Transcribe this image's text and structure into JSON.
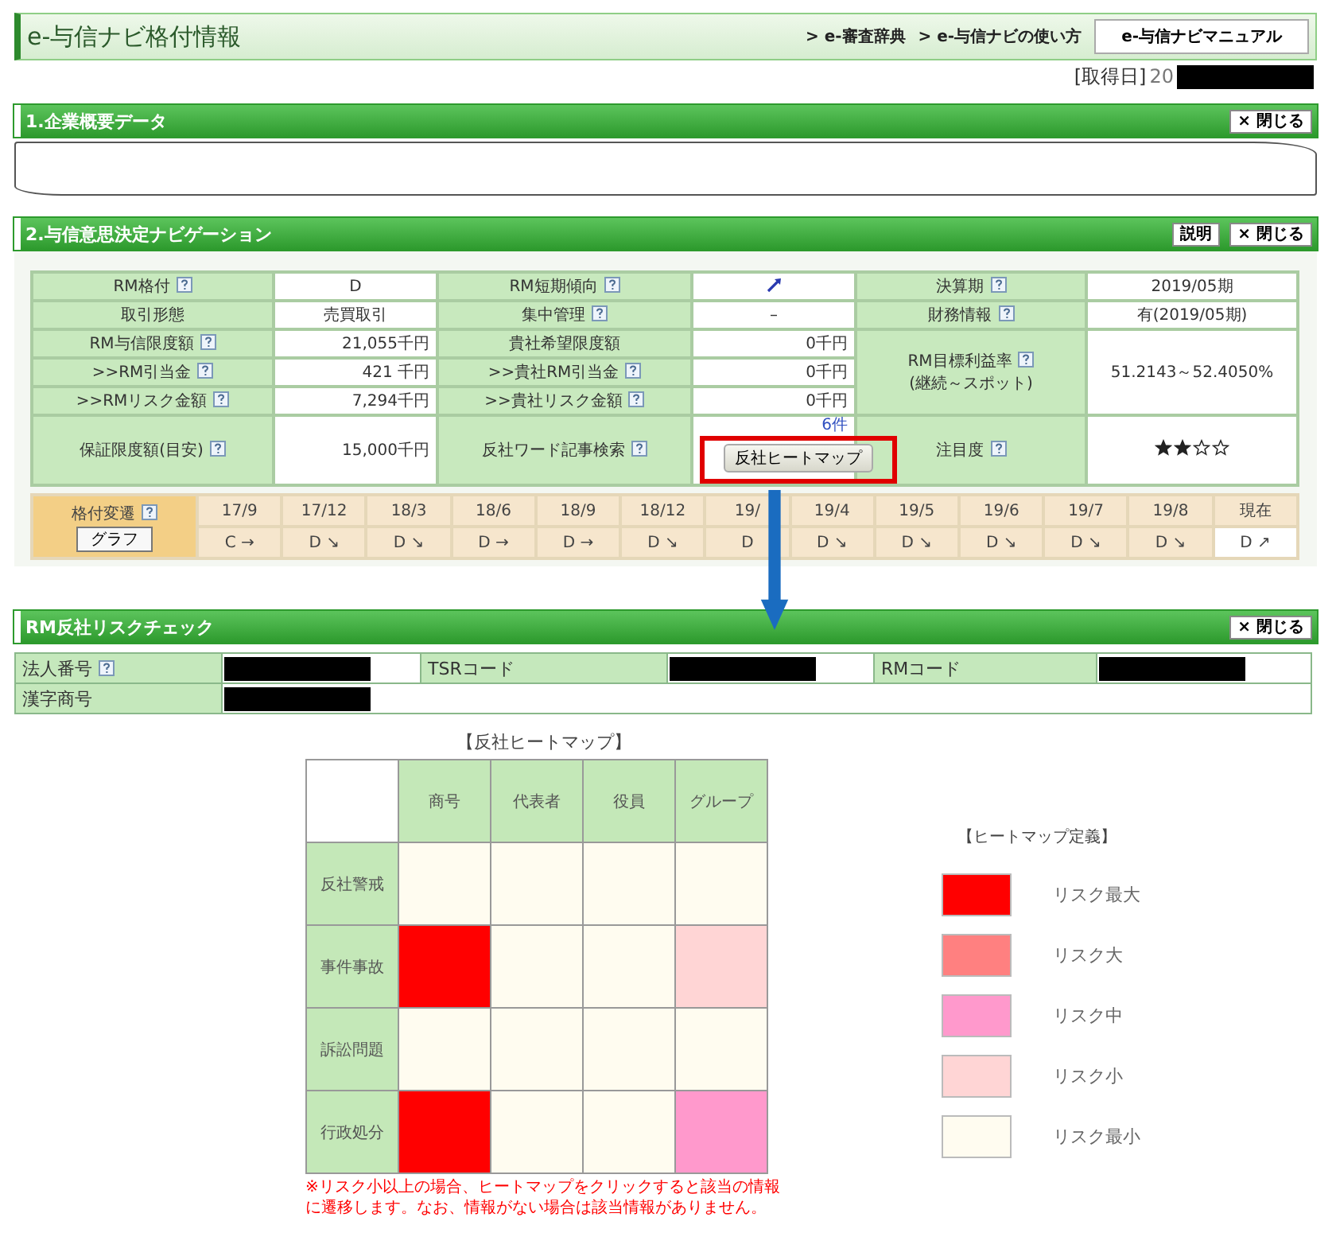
{
  "header": {
    "title": "e-与信ナビ格付情報",
    "links": [
      "> e-審査辞典",
      "> e-与信ナビの使い方"
    ],
    "manual_button": "e-与信ナビマニュアル"
  },
  "acquired": {
    "label": "[取得日]",
    "value": "20",
    "redacted": true
  },
  "company_section": {
    "title": "1.企業概要データ",
    "close": "× 閉じる"
  },
  "navigation_section": {
    "title": "2.与信意思決定ナビゲーション",
    "help_button": "説明",
    "close": "× 閉じる",
    "rows": [
      [
        {
          "kind": "label",
          "text": "RM格付",
          "help": true
        },
        {
          "kind": "value",
          "text": "D"
        },
        {
          "kind": "label",
          "text": "RM短期傾向",
          "help": true
        },
        {
          "kind": "icon"
        },
        {
          "kind": "label",
          "text": "決算期",
          "help": true
        },
        {
          "kind": "value",
          "text": "2019/05期"
        }
      ],
      [
        {
          "kind": "label",
          "text": "取引形態",
          "help": false
        },
        {
          "kind": "value",
          "text": "売買取引"
        },
        {
          "kind": "label",
          "text": "集中管理",
          "help": true
        },
        {
          "kind": "value",
          "text": "–"
        },
        {
          "kind": "label",
          "text": "財務情報",
          "help": true
        },
        {
          "kind": "value",
          "text": "有(2019/05期)"
        }
      ],
      [
        {
          "kind": "label",
          "text": "RM与信限度額",
          "help": true
        },
        {
          "kind": "amount",
          "text": "21,055千円"
        },
        {
          "kind": "label",
          "text": "貴社希望限度額",
          "help": false
        },
        {
          "kind": "amount",
          "text": "0千円"
        },
        {
          "kind": "tall_label",
          "text": "RM目標利益率",
          "sub": "(継続～スポット)",
          "help": true,
          "rowspan": 3
        },
        {
          "kind": "tall_value",
          "text": "51.2143～52.4050%",
          "rowspan": 3
        }
      ],
      [
        {
          "kind": "label",
          "text": ">>RM引当金",
          "help": true
        },
        {
          "kind": "amount",
          "text": "421 千円"
        },
        {
          "kind": "label",
          "text": ">>貴社RM引当金",
          "help": true
        },
        {
          "kind": "amount",
          "text": "0千円"
        }
      ],
      [
        {
          "kind": "label",
          "text": ">>RMリスク金額",
          "help": true
        },
        {
          "kind": "amount",
          "text": "7,294千円"
        },
        {
          "kind": "label",
          "text": ">>貴社リスク金額",
          "help": true
        },
        {
          "kind": "amount",
          "text": "0千円"
        }
      ],
      [
        {
          "kind": "label",
          "text": "保証限度額(目安)",
          "help": true
        },
        {
          "kind": "amount",
          "text": "15,000千円"
        },
        {
          "kind": "label",
          "text": "反社ワード記事検索",
          "help": true
        },
        {
          "kind": "search",
          "count": "6件",
          "button": "反社ヒートマップ",
          "highlighted": true
        },
        {
          "kind": "label",
          "text": "注目度",
          "help": true
        },
        {
          "kind": "stars",
          "stars": 2
        }
      ]
    ],
    "history": {
      "label": "格付変遷",
      "help": true,
      "graph_button": "グラフ",
      "periods": [
        {
          "period": "17/9",
          "rating": "C →",
          "current": false
        },
        {
          "period": "17/12",
          "rating": "D ↘",
          "current": false
        },
        {
          "period": "18/3",
          "rating": "D ↘",
          "current": false
        },
        {
          "period": "18/6",
          "rating": "D →",
          "current": false
        },
        {
          "period": "18/9",
          "rating": "D →",
          "current": false
        },
        {
          "period": "18/12",
          "rating": "D ↘",
          "current": false
        },
        {
          "period": "19/",
          "rating": "D",
          "current": false
        },
        {
          "period": "19/4",
          "rating": "D ↘",
          "current": false
        },
        {
          "period": "19/5",
          "rating": "D ↘",
          "current": false
        },
        {
          "period": "19/6",
          "rating": "D ↘",
          "current": false
        },
        {
          "period": "19/7",
          "rating": "D ↘",
          "current": false
        },
        {
          "period": "19/8",
          "rating": "D ↘",
          "current": false
        },
        {
          "period": "現在",
          "rating": "D ↗",
          "current": true
        }
      ]
    }
  },
  "risk_section": {
    "title": "RM反社リスクチェック",
    "close": "× 閉じる",
    "fields": [
      {
        "label": "法人番号",
        "help": true,
        "redacted": true
      },
      {
        "label": "TSRコード",
        "help": false,
        "redacted": true
      },
      {
        "label": "RMコード",
        "help": false,
        "redacted": true
      }
    ],
    "second_row": [
      {
        "label": "漢字商号",
        "help": false,
        "redacted": true
      }
    ]
  },
  "heatmap": {
    "title": "【反社ヒートマップ】",
    "columns": [
      "商号",
      "代表者",
      "役員",
      "グループ"
    ],
    "rows": [
      {
        "label": "反社警戒",
        "cells": [
          {
            "color": "#fffcf0"
          },
          {
            "color": "#fffcf0"
          },
          {
            "color": "#fffcf0"
          },
          {
            "color": "#fffcf0"
          }
        ]
      },
      {
        "label": "事件事故",
        "cells": [
          {
            "color": "#ff0000"
          },
          {
            "color": "#fffcf0"
          },
          {
            "color": "#fffcf0"
          },
          {
            "color": "#ffd5d5"
          }
        ]
      },
      {
        "label": "訴訟問題",
        "cells": [
          {
            "color": "#fffcf0"
          },
          {
            "color": "#fffcf0"
          },
          {
            "color": "#fffcf0"
          },
          {
            "color": "#fffcf0"
          }
        ]
      },
      {
        "label": "行政処分",
        "cells": [
          {
            "color": "#ff0000"
          },
          {
            "color": "#fffcf0"
          },
          {
            "color": "#fffcf0"
          },
          {
            "color": "#ff99cc"
          }
        ]
      }
    ],
    "note": "※リスク小以上の場合、ヒートマップをクリックすると該当の情報に遷移します。なお、情報がない場合は該当情報がありません。"
  },
  "legend": {
    "title": "【ヒートマップ定義】",
    "items": [
      {
        "label": "リスク最大",
        "color": "#ff0000"
      },
      {
        "label": "リスク大",
        "color": "#ff8080"
      },
      {
        "label": "リスク中",
        "color": "#ff99cc"
      },
      {
        "label": "リスク小",
        "color": "#ffd5d5"
      },
      {
        "label": "リスク最小",
        "color": "#fffcf0"
      }
    ]
  }
}
